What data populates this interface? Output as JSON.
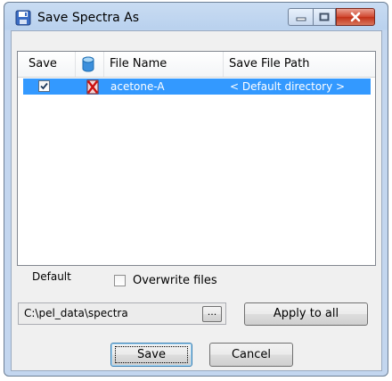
{
  "window": {
    "title": "Save Spectra As"
  },
  "list": {
    "columns": {
      "save": "Save",
      "file_name": "File Name",
      "save_path": "Save File Path"
    },
    "rows": [
      {
        "checked": true,
        "file_name": "acetone-A",
        "save_path": "< Default directory >"
      }
    ]
  },
  "options": {
    "default_label": "Default",
    "overwrite_label": "Overwrite files",
    "overwrite_checked": false
  },
  "path": {
    "value": "C:\\pel_data\\spectra",
    "browse_label": "...",
    "apply_label": "Apply to all"
  },
  "buttons": {
    "save": "Save",
    "cancel": "Cancel"
  },
  "colors": {
    "selection": "#3399ff",
    "close_button": "#c23219",
    "titlebar": "#b9d1ee"
  }
}
